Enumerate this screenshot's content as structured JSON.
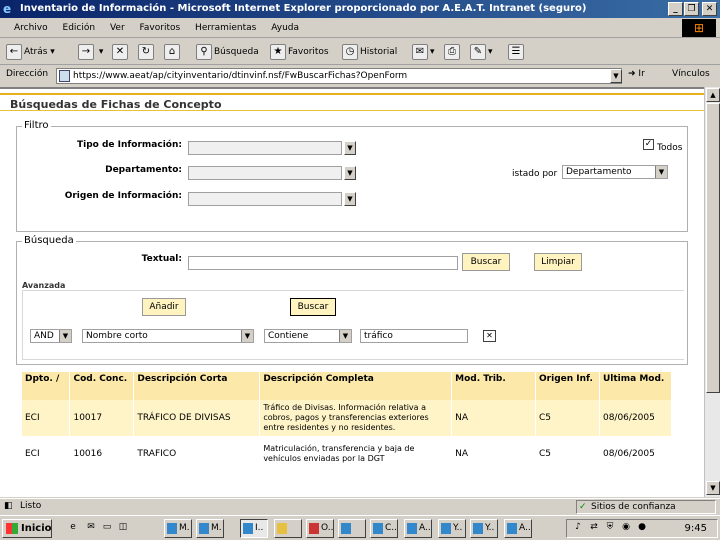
{
  "window": {
    "title": "Inventario de Información - Microsoft Internet Explorer proporcionado por A.E.A.T. Intranet (seguro)",
    "minimize": "_",
    "maximize": "❐",
    "close": "✕"
  },
  "menu": [
    "Archivo",
    "Edición",
    "Ver",
    "Favoritos",
    "Herramientas",
    "Ayuda"
  ],
  "toolbar": {
    "back": "Atrás",
    "search": "Búsqueda",
    "favorites": "Favoritos",
    "history": "Historial"
  },
  "address": {
    "label": "Dirección",
    "url": "https://www.aeat/ap/cityinventario/dtinvinf.nsf/FwBuscarFichas?OpenForm",
    "go": "Ir",
    "links": "Vínculos"
  },
  "page": {
    "title": "Búsquedas de Fichas de Concepto",
    "filter": {
      "legend": "Filtro",
      "tipo_label": "Tipo de Información:",
      "departamento_label": "Departamento:",
      "origen_label": "Origen de Información:",
      "todos_check": "✓",
      "todos_label": "Todos",
      "listado_label": "istado por",
      "listado_value": "Departamento"
    },
    "search": {
      "legend": "Búsqueda",
      "textual_label": "Textual:",
      "buscar": "Buscar",
      "limpiar": "Limpiar",
      "advanced_label": "Avanzada",
      "anadir": "Añadir",
      "buscar2": "Buscar",
      "op_value": "AND",
      "field_value": "Nombre corto",
      "cond_value": "Contiene",
      "term_value": "tráfico",
      "remove": "✕"
    },
    "results": {
      "headers": [
        "Dpto. /",
        "Cod. Conc.",
        "Descripción Corta",
        "Descripción Completa",
        "Mod. Trib.",
        "Origen Inf.",
        "Ultima Mod."
      ],
      "rows": [
        [
          "ECI",
          "10017",
          "TRÁFICO DE DIVISAS",
          "Tráfico de Divisas. Información relativa a cobros, pagos y transferencias exteriores entre residentes y no residentes.",
          "NA",
          "C5",
          "08/06/2005"
        ],
        [
          "ECI",
          "10016",
          "TRAFICO",
          "Matriculación, transferencia y baja de vehículos enviadas por la DGT",
          "NA",
          "C5",
          "08/06/2005"
        ]
      ]
    }
  },
  "status": {
    "text": "Listo",
    "zone": "Sitios de confianza"
  },
  "taskbar": {
    "start": "Inicio",
    "tasks": [
      "M.",
      "M.",
      "I..",
      "",
      "O..",
      "",
      "C..",
      "A..",
      "Y..",
      "Y..",
      "A.."
    ],
    "clock": "9:45"
  }
}
